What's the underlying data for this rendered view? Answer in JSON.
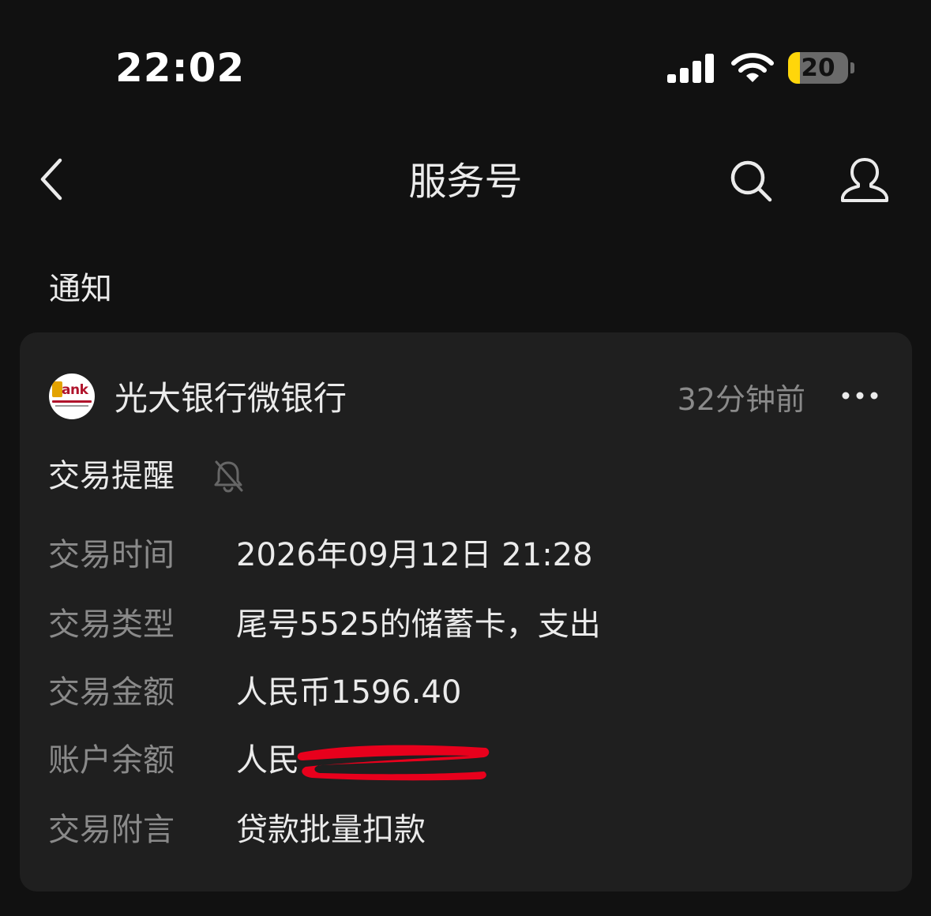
{
  "status_bar": {
    "time": "22:02",
    "battery_level": "20",
    "battery_fraction": 0.2,
    "signal": "signal-icon",
    "wifi": "wifi-icon"
  },
  "nav": {
    "title": "服务号",
    "back_icon": "chevron-left-icon",
    "search_icon": "search-icon",
    "profile_icon": "user-icon"
  },
  "section": {
    "label": "通知"
  },
  "card": {
    "sender_name": "光大银行微银行",
    "sender_time": "32分钟前",
    "logo_text": "Eank",
    "message_title": "交易提醒",
    "rows": [
      {
        "label": "交易时间",
        "value": "2026年09月12日 21:28"
      },
      {
        "label": "交易类型",
        "value": "尾号5525的储蓄卡，支出"
      },
      {
        "label": "交易金额",
        "value": "人民币1596.40"
      },
      {
        "label": "账户余额",
        "value": "人民"
      },
      {
        "label": "交易附言",
        "value": "贷款批量扣款"
      }
    ]
  },
  "colors": {
    "background": "#111111",
    "card": "#1f1f1f",
    "primary_text": "#ebebeb",
    "secondary_text": "#8a8a8a",
    "battery_accent": "#ffd60a",
    "redaction": "#e8001c"
  }
}
